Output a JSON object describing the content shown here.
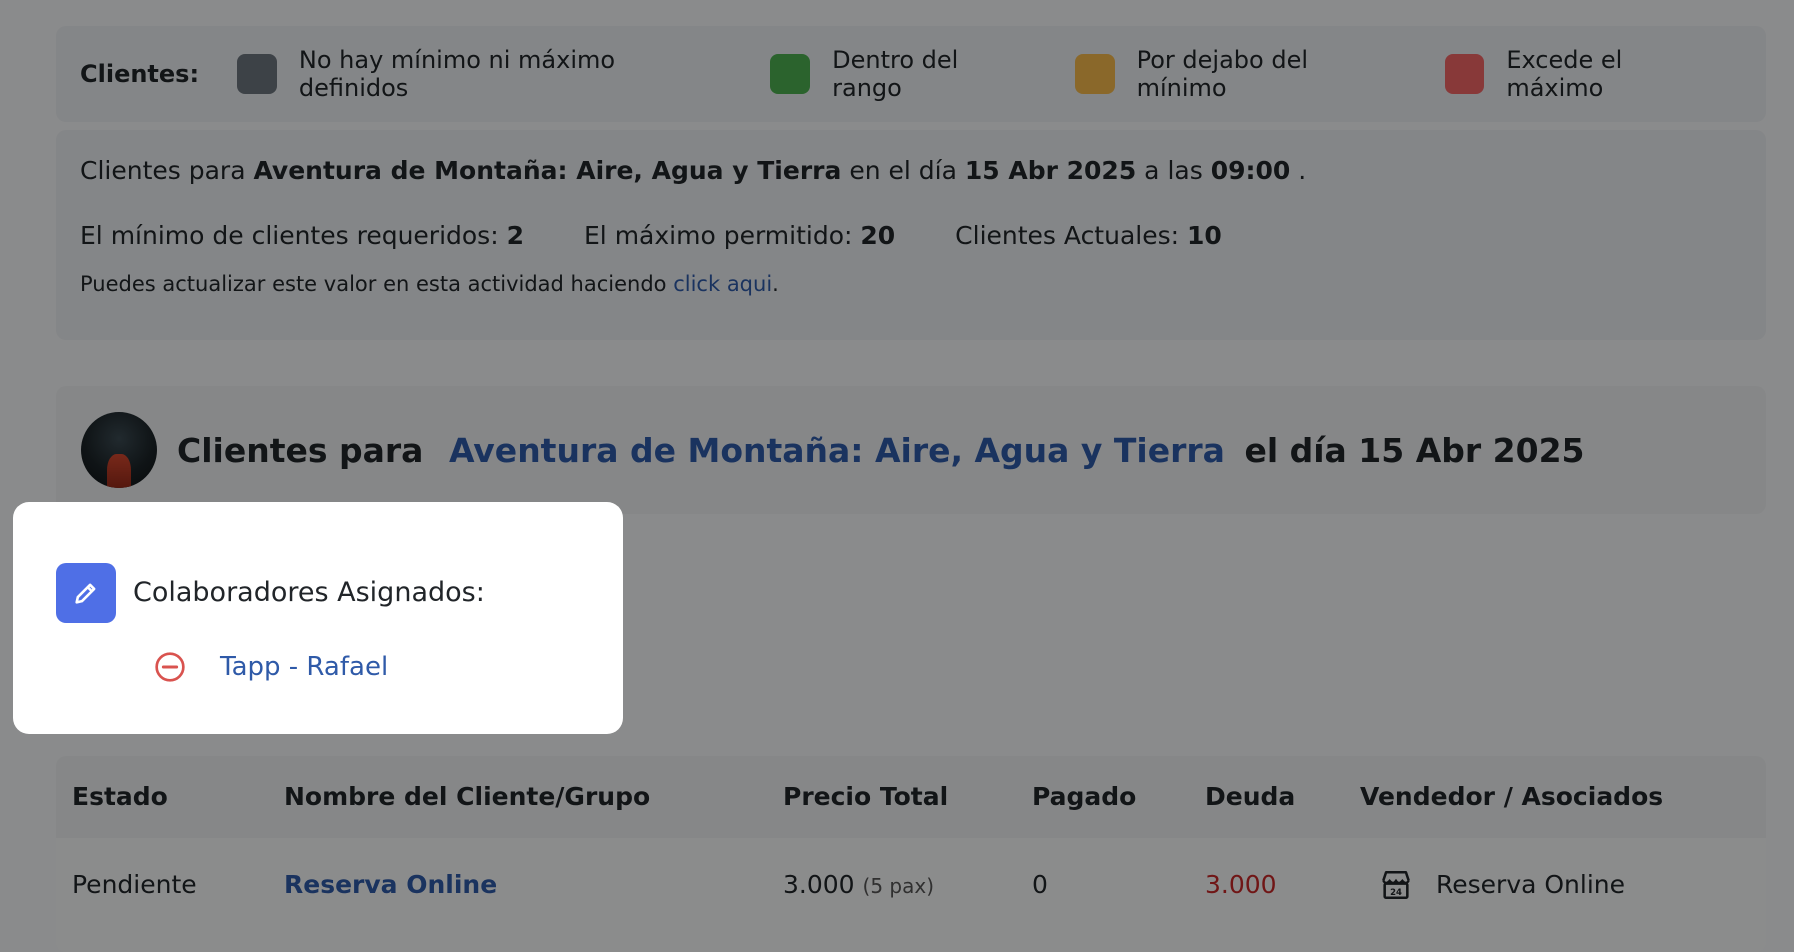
{
  "legend": {
    "title": "Clientes:",
    "items": [
      {
        "label": "No hay mínimo ni máximo definidos",
        "color": "#6c757d"
      },
      {
        "label": "Dentro del rango",
        "color": "#4caf50"
      },
      {
        "label": "Por dejabo del mínimo",
        "color": "#f2b84b"
      },
      {
        "label": "Excede el máximo",
        "color": "#f06464"
      }
    ]
  },
  "info": {
    "prefix": "Clientes para",
    "activity": "Aventura de Montaña: Aire, Agua y Tierra",
    "day_text": "en el día",
    "date": "15 Abr 2025",
    "at_text": "a las",
    "time": "09:00",
    "period": ".",
    "min_label": "El mínimo de clientes requeridos:",
    "min_value": "2",
    "max_label": "El máximo permitido:",
    "max_value": "20",
    "current_label": "Clientes Actuales:",
    "current_value": "10",
    "note": "Puedes actualizar este valor en esta actividad haciendo",
    "note_link": "click aqui",
    "note_end": "."
  },
  "header": {
    "prefix": "Clientes para",
    "activity": "Aventura de Montaña: Aire, Agua y Tierra",
    "suffix": "el día 15 Abr 2025"
  },
  "popover": {
    "title": "Colaboradores Asignados:",
    "collaborator": "Tapp - Rafael"
  },
  "table": {
    "headers": [
      "Estado",
      "Nombre del Cliente/Grupo",
      "Precio Total",
      "Pagado",
      "Deuda",
      "Vendedor / Asociados"
    ],
    "row": {
      "estado": "Pendiente",
      "nombre": "Reserva Online",
      "precio": "3.000",
      "pax": "(5 pax)",
      "pagado": "0",
      "deuda": "3.000",
      "vendedor": "Reserva Online"
    }
  }
}
